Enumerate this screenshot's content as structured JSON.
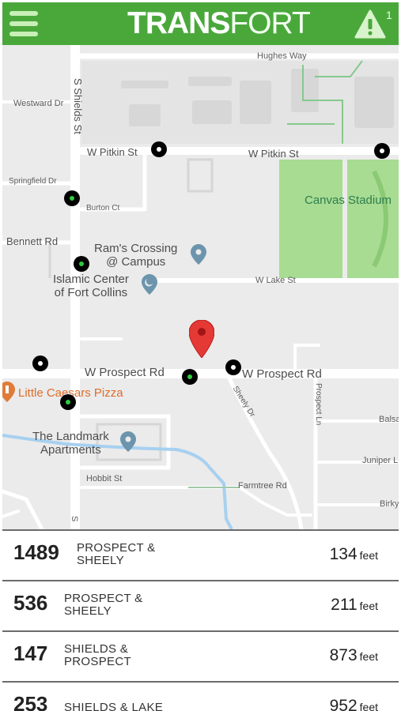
{
  "header": {
    "logo_bold": "TRANS",
    "logo_light": "FORT",
    "alert_count": "1",
    "colors": {
      "bar": "#4aa83b",
      "menu": "#c9efb9"
    },
    "icons": {
      "menu": "hamburger-menu-icon",
      "alert": "warning-triangle-icon"
    }
  },
  "map": {
    "labels": {
      "hughes_way": "Hughes Way",
      "westward_dr": "Westward Dr",
      "s_shields_st": "S Shields St",
      "w_pitkin_st_1": "W Pitkin St",
      "w_pitkin_st_2": "W Pitkin St",
      "springfield_dr": "Springfield Dr",
      "burton_ct": "Burton Ct",
      "canvas_stadium": "Canvas Stadium",
      "bennett_rd": "Bennett Rd",
      "rams_crossing": "Ram's Crossing\n@ Campus",
      "islamic_center": "Islamic Center\nof Fort Collins",
      "w_lake_st": "W Lake St",
      "w_prospect_rd_1": "W Prospect Rd",
      "w_prospect_rd_2": "W Prospect Rd",
      "little_caesars": "Little Caesars Pizza",
      "sheely_dr": "Sheely Dr",
      "prospect_ln": "Prospect Ln",
      "balsa": "Balsa",
      "landmark_apartments": "The Landmark\nApartments",
      "juniper_l": "Juniper L",
      "hobbit_st": "Hobbit St",
      "farmtree_rd": "Farmtree Rd",
      "birk": "Birky",
      "s_bottom": "S"
    },
    "colors": {
      "stop": "#000000",
      "stop_active_dot": "#2ecc40",
      "pin": "#e53935",
      "park": "#a7dc92",
      "poi": "#6c95ad"
    }
  },
  "stops": [
    {
      "number": "1489",
      "name": "PROSPECT &\nSHEELY",
      "distance": "134",
      "unit": "feet"
    },
    {
      "number": "536",
      "name": "PROSPECT &\nSHEELY",
      "distance": "211",
      "unit": "feet"
    },
    {
      "number": "147",
      "name": "SHIELDS &\nPROSPECT",
      "distance": "873",
      "unit": "feet"
    },
    {
      "number": "253",
      "name": "SHIELDS & LAKE",
      "distance": "952",
      "unit": "feet"
    }
  ]
}
